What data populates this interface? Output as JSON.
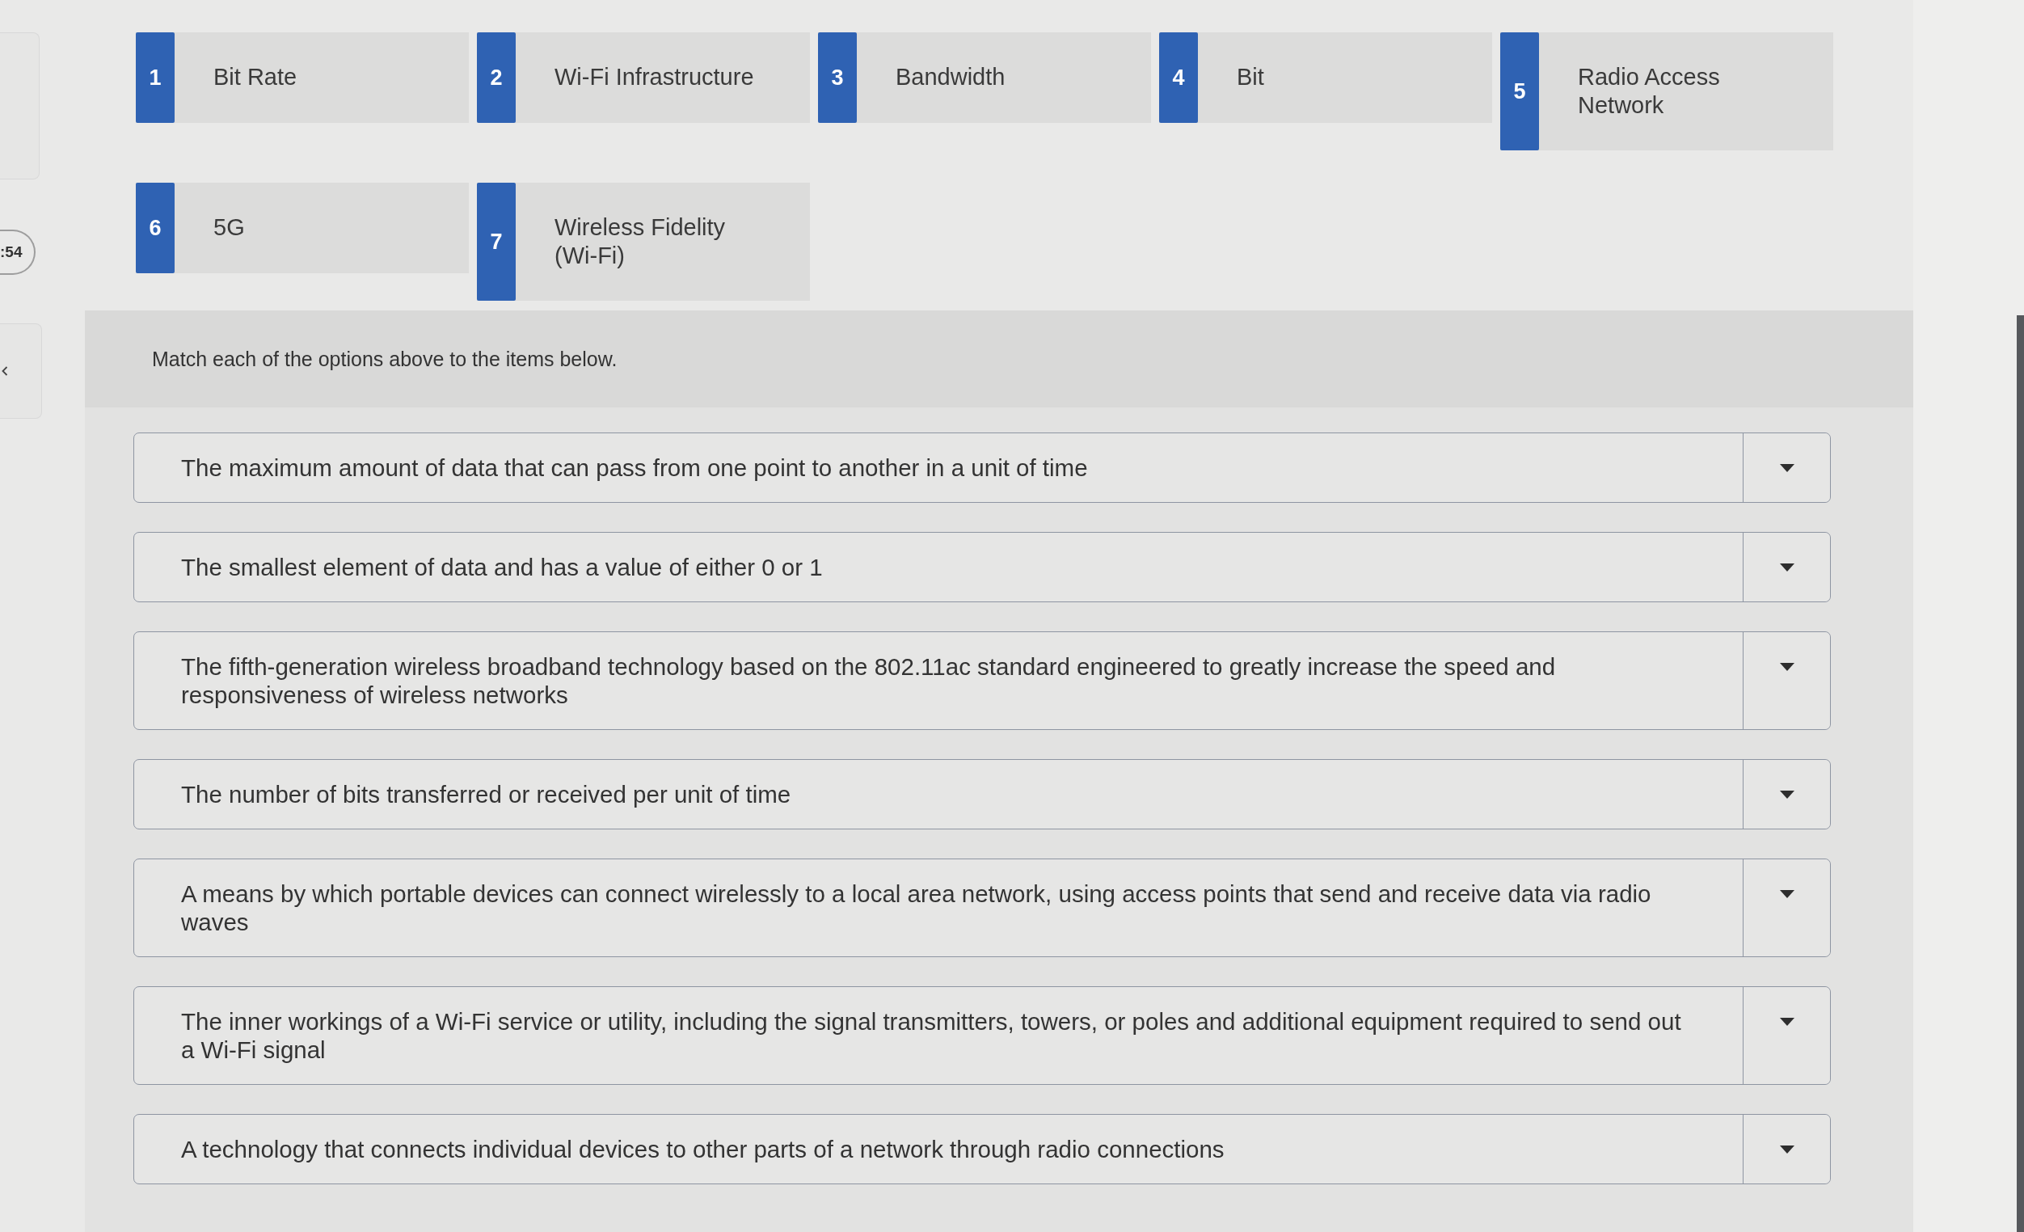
{
  "timer": {
    "text": ":54"
  },
  "options": [
    {
      "number": "1",
      "label": "Bit Rate"
    },
    {
      "number": "2",
      "label": "Wi-Fi Infrastructure"
    },
    {
      "number": "3",
      "label": "Bandwidth"
    },
    {
      "number": "4",
      "label": "Bit"
    },
    {
      "number": "5",
      "label": "Radio Access Network"
    },
    {
      "number": "6",
      "label": "5G"
    },
    {
      "number": "7",
      "label": "Wireless Fidelity (Wi-Fi)"
    }
  ],
  "question": {
    "instruction": "Match each of the options above to the items below.",
    "items": [
      {
        "prompt": "The maximum amount of data that can pass from one point to another in a unit of time"
      },
      {
        "prompt": "The smallest element of data and has a value of either 0 or 1"
      },
      {
        "prompt": "The fifth-generation wireless broadband technology based on the 802.11ac standard engineered to greatly increase the speed and responsiveness of wireless networks"
      },
      {
        "prompt": "The number of bits transferred or received per unit of time"
      },
      {
        "prompt": "A means by which portable devices can connect wirelessly to a local area network, using access points that send and receive data via radio waves"
      },
      {
        "prompt": "The inner workings of a Wi-Fi service or utility, including the signal transmitters, towers, or poles and additional equipment required to send out a Wi-Fi signal"
      },
      {
        "prompt": "A technology that connects individual devices to other parts of a network through radio connections"
      }
    ]
  }
}
